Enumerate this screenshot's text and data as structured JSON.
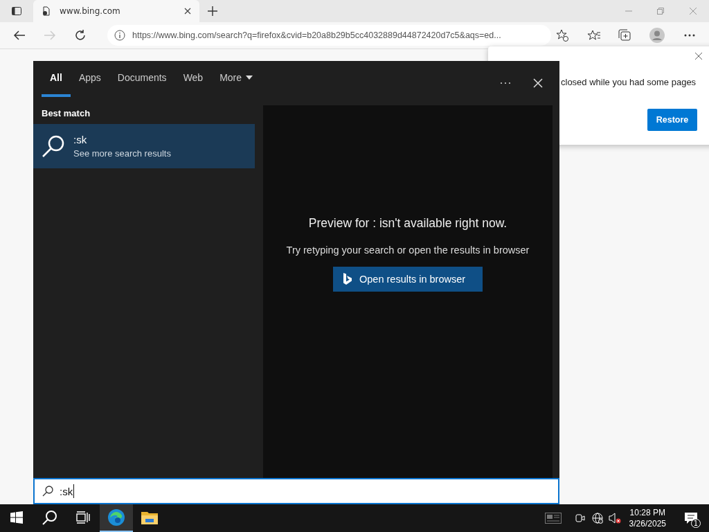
{
  "browser": {
    "tab": {
      "title": "www.bing.com"
    },
    "url": "https://www.bing.com/search?q=firefox&cvid=b20a8b29b5cc4032889d44872420d7c5&aqs=ed..."
  },
  "restore_popup": {
    "message": "closed while you had some pages",
    "button": "Restore"
  },
  "search_panel": {
    "tabs": [
      {
        "label": "All",
        "selected": true
      },
      {
        "label": "Apps",
        "selected": false
      },
      {
        "label": "Documents",
        "selected": false
      },
      {
        "label": "Web",
        "selected": false
      },
      {
        "label": "More",
        "selected": false,
        "kind": "dropdown"
      }
    ],
    "section": "Best match",
    "results": [
      {
        "title": ":sk",
        "subtitle": "See more search results",
        "selected": true
      }
    ],
    "preview": {
      "heading": "Preview for : isn't available right now.",
      "hint": "Try retyping your search or open the results in browser",
      "button": "Open results in browser"
    },
    "query": ":sk"
  },
  "taskbar": {
    "apps": [
      {
        "kind": "start",
        "selected": false
      },
      {
        "kind": "search",
        "selected": false
      },
      {
        "kind": "taskview",
        "selected": false
      },
      {
        "kind": "edge",
        "selected": true
      },
      {
        "kind": "explorer",
        "selected": false
      }
    ],
    "time": "10:28 PM",
    "date": "3/26/2025",
    "notifications": "1"
  }
}
